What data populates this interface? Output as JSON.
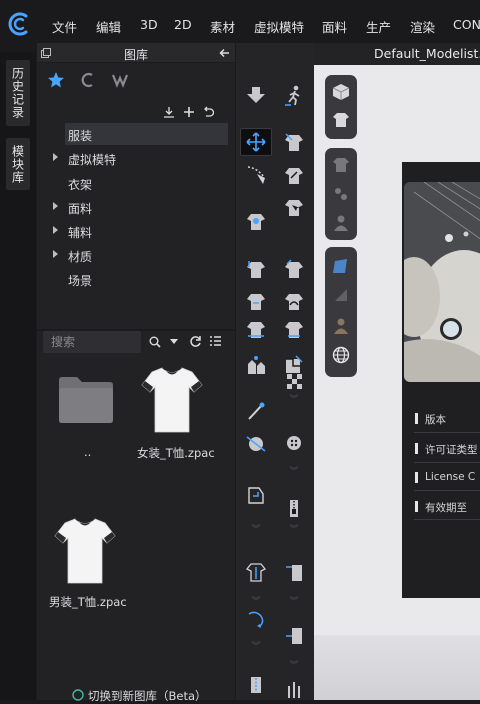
{
  "menubar": {
    "items": [
      "文件",
      "编辑",
      "3D",
      "2D",
      "素材",
      "虚拟模特",
      "面料",
      "生产",
      "渲染",
      "CON"
    ]
  },
  "side_tabs": [
    "历史记录",
    "模块库"
  ],
  "library": {
    "title": "图库",
    "tree": [
      {
        "label": "服装",
        "expandable": false,
        "selected": true
      },
      {
        "label": "虚拟模特",
        "expandable": true,
        "selected": false
      },
      {
        "label": "衣架",
        "expandable": false,
        "selected": false
      },
      {
        "label": "面料",
        "expandable": true,
        "selected": false
      },
      {
        "label": "辅料",
        "expandable": true,
        "selected": false
      },
      {
        "label": "材质",
        "expandable": true,
        "selected": false
      },
      {
        "label": "场景",
        "expandable": false,
        "selected": false
      }
    ],
    "search_placeholder": "搜索",
    "files": [
      {
        "name": "..",
        "type": "folder-icon"
      },
      {
        "name": "女装_T恤.zpac",
        "type": "tshirt-icon"
      },
      {
        "name": "男装_T恤.zpac",
        "type": "tshirt-icon"
      }
    ],
    "footer": "切换到新图库（Beta）"
  },
  "viewport": {
    "tab_title": "Default_Modelist.z",
    "license_rows": [
      "版本",
      "许可证类型",
      "License C",
      "有效期至"
    ]
  },
  "colors": {
    "accent": "#4aa3ff",
    "panel": "#222225",
    "menubar": "#1a1a1c",
    "viewport": "#e9e9ec"
  }
}
